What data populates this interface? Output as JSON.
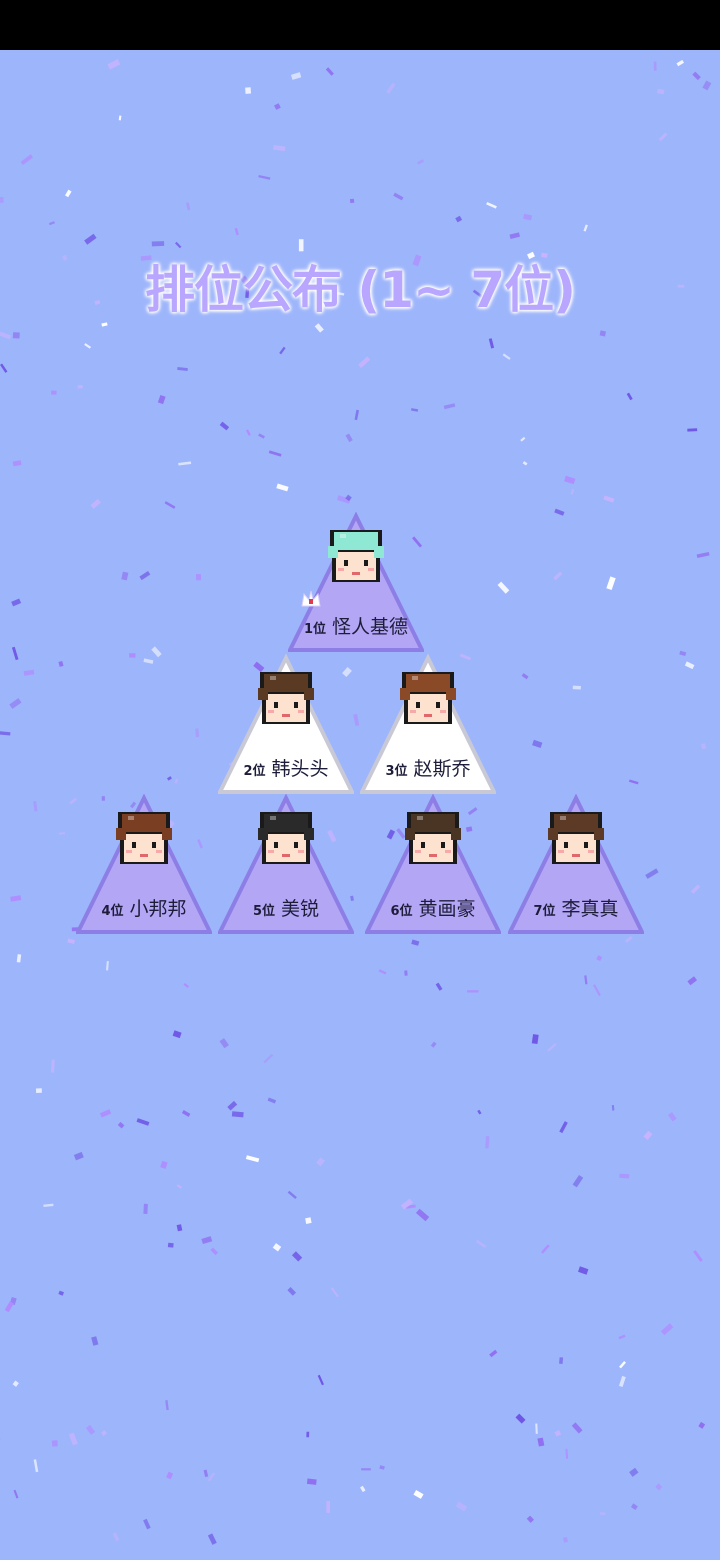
{
  "title": "排位公布 (1~ 7位)",
  "colors": {
    "background": "#9db5fb",
    "card_purple": "#b3a6f5",
    "card_purple_edge": "#8d7ee6",
    "card_white": "#ffffff",
    "card_white_edge": "#c9c9d6",
    "confetti_colors": [
      "#8f6cf0",
      "#b08cff",
      "#6f56e6",
      "#c7b3ff",
      "#ffffff"
    ]
  },
  "rankings": [
    {
      "rank_label": "1位",
      "name": "怪人基德",
      "hair": "#8ee8d3",
      "card": "purple",
      "crown": true
    },
    {
      "rank_label": "2位",
      "name": "韩头头",
      "hair": "#5a3a22",
      "card": "white",
      "crown": false
    },
    {
      "rank_label": "3位",
      "name": "赵斯乔",
      "hair": "#8a4a28",
      "card": "white",
      "crown": false
    },
    {
      "rank_label": "4位",
      "name": "小邦邦",
      "hair": "#7a3f22",
      "card": "purple",
      "crown": false
    },
    {
      "rank_label": "5位",
      "name": "美锐",
      "hair": "#2a2a2a",
      "card": "purple",
      "crown": false
    },
    {
      "rank_label": "6位",
      "name": "黄画豪",
      "hair": "#4a3424",
      "card": "purple",
      "crown": false
    },
    {
      "rank_label": "7位",
      "name": "李真真",
      "hair": "#5c3a26",
      "card": "purple",
      "crown": false
    }
  ]
}
